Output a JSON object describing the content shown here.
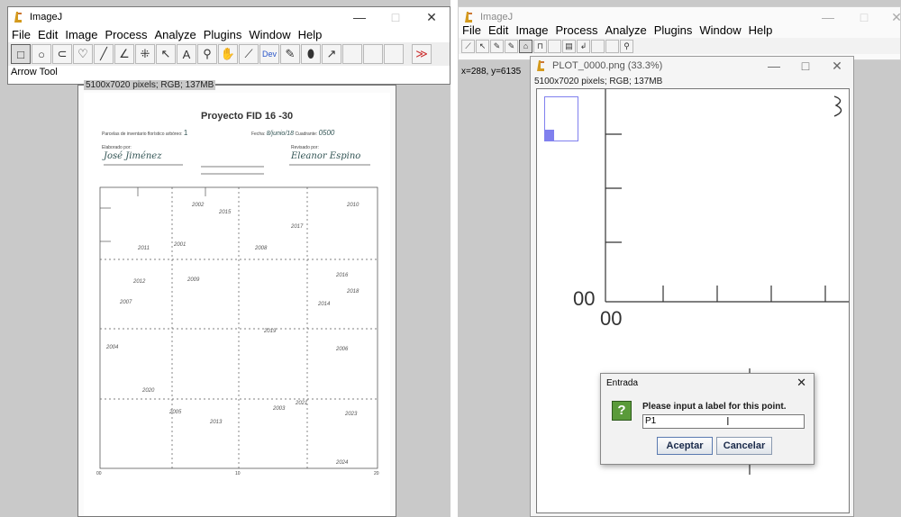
{
  "left": {
    "title": "ImageJ",
    "controls": {
      "minimize": "—",
      "maximize": "□",
      "close": "✕"
    },
    "menu": [
      "File",
      "Edit",
      "Image",
      "Process",
      "Analyze",
      "Plugins",
      "Window",
      "Help"
    ],
    "tools": [
      {
        "icon": "rectangle-tool-icon",
        "glyph": "□"
      },
      {
        "icon": "oval-tool-icon",
        "glyph": "○"
      },
      {
        "icon": "polygon-tool-icon",
        "glyph": "⊂"
      },
      {
        "icon": "freehand-tool-icon",
        "glyph": "♡"
      },
      {
        "icon": "line-tool-icon",
        "glyph": "╱"
      },
      {
        "icon": "angle-tool-icon",
        "glyph": "∠"
      },
      {
        "icon": "point-tool-icon",
        "glyph": "⁜"
      },
      {
        "icon": "wand-tool-icon",
        "glyph": "↖"
      },
      {
        "icon": "text-tool-icon",
        "glyph": "A"
      },
      {
        "icon": "magnifier-tool-icon",
        "glyph": "⚲"
      },
      {
        "icon": "hand-tool-icon",
        "glyph": "✋"
      },
      {
        "icon": "dropper-tool-icon",
        "glyph": "⟋"
      },
      {
        "icon": "dev-tool-icon",
        "glyph": "Dev"
      },
      {
        "icon": "brush-tool-icon",
        "glyph": "✎"
      },
      {
        "icon": "flood-fill-tool-icon",
        "glyph": "⬮"
      },
      {
        "icon": "arrow-pen-tool-icon",
        "glyph": "↗"
      },
      {
        "icon": "empty-slot-icon",
        "glyph": ""
      },
      {
        "icon": "empty-slot-icon",
        "glyph": ""
      },
      {
        "icon": "empty-slot-icon",
        "glyph": ""
      },
      {
        "icon": "more-tools-icon",
        "glyph": "≫"
      }
    ],
    "status": "Arrow Tool",
    "image_info": "5100x7020 pixels; RGB; 137MB",
    "doc": {
      "title": "Proyecto FID 16 -30",
      "line1_label": "Parcelas de inventario florístico arbóreo:",
      "line1_value": "1",
      "fecha_label": "Fecha:",
      "fecha_value": "8/junio/18",
      "cuadrante_label": "Cuadrante:",
      "cuadrante_value": "0500",
      "elaborado_label": "Elaborado por:",
      "elaborado_value": "José Jiménez",
      "revisado_label": "Revisado por:",
      "revisado_value": "Eleanor Espino",
      "corner_0": "00",
      "corner_10": "10",
      "corner_20": "20",
      "tags": [
        "2002",
        "2015",
        "2010",
        "2017",
        "2011",
        "2001",
        "2008",
        "2009",
        "2012",
        "2007",
        "2016",
        "2018",
        "2014",
        "2019",
        "2004",
        "2006",
        "2020",
        "2005",
        "2003",
        "2013",
        "2021",
        "2023",
        "2024"
      ]
    }
  },
  "right": {
    "title": "ImageJ",
    "menu": [
      "File",
      "Edit",
      "Image",
      "Process",
      "Analyze",
      "Plugins",
      "Window",
      "Help"
    ],
    "status": "x=288, y=6135",
    "plot_window": {
      "title": "PLOT_0000.png (33.3%)",
      "info": "5100x7020 pixels; RGB; 137MB",
      "axis_label_left": "00",
      "axis_label_bottom": "00"
    },
    "dialog": {
      "title": "Entrada",
      "question_glyph": "?",
      "prompt": "Please input a label for this point.",
      "input_value": "P1",
      "ok": "Aceptar",
      "cancel": "Cancelar",
      "close": "✕"
    }
  },
  "colors": {
    "accent": "#2b57c9",
    "roi": "#8080ee",
    "dialog_icon": "#5a9b3a"
  }
}
